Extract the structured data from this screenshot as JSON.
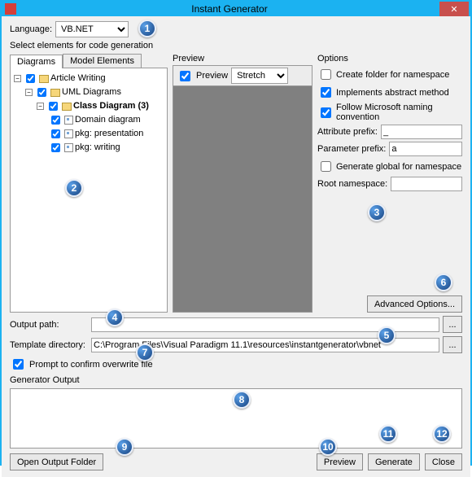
{
  "window": {
    "title": "Instant Generator"
  },
  "language": {
    "label": "Language:",
    "value": "VB.NET"
  },
  "select_label": "Select elements for code generation",
  "tabs": {
    "diagrams": "Diagrams",
    "model_elements": "Model Elements"
  },
  "tree": {
    "root": "Article Writing",
    "uml": "UML Diagrams",
    "class_diagram": "Class Diagram (3)",
    "items": [
      "Domain diagram",
      "pkg: presentation",
      "pkg: writing"
    ]
  },
  "preview": {
    "title": "Preview",
    "checkbox": "Preview",
    "mode": "Stretch"
  },
  "options": {
    "title": "Options",
    "create_folder": "Create folder for namespace",
    "implements_abstract": "Implements abstract method",
    "follow_ms": "Follow Microsoft naming convention",
    "attr_prefix_label": "Attribute prefix:",
    "attr_prefix_value": "_",
    "param_prefix_label": "Parameter prefix:",
    "param_prefix_value": "a",
    "gen_global": "Generate global for namespace",
    "root_ns_label": "Root namespace:",
    "root_ns_value": "",
    "advanced": "Advanced Options..."
  },
  "paths": {
    "output_label": "Output path:",
    "output_value": "",
    "template_label": "Template directory:",
    "template_value": "C:\\Program Files\\Visual Paradigm 11.1\\resources\\instantgenerator\\vbnet",
    "browse": "..."
  },
  "prompt_overwrite": "Prompt to confirm overwrite file",
  "generator_output": "Generator Output",
  "buttons": {
    "open_output": "Open Output Folder",
    "preview": "Preview",
    "generate": "Generate",
    "close": "Close"
  },
  "markers": [
    "1",
    "2",
    "3",
    "4",
    "5",
    "6",
    "7",
    "8",
    "9",
    "10",
    "11",
    "12"
  ]
}
